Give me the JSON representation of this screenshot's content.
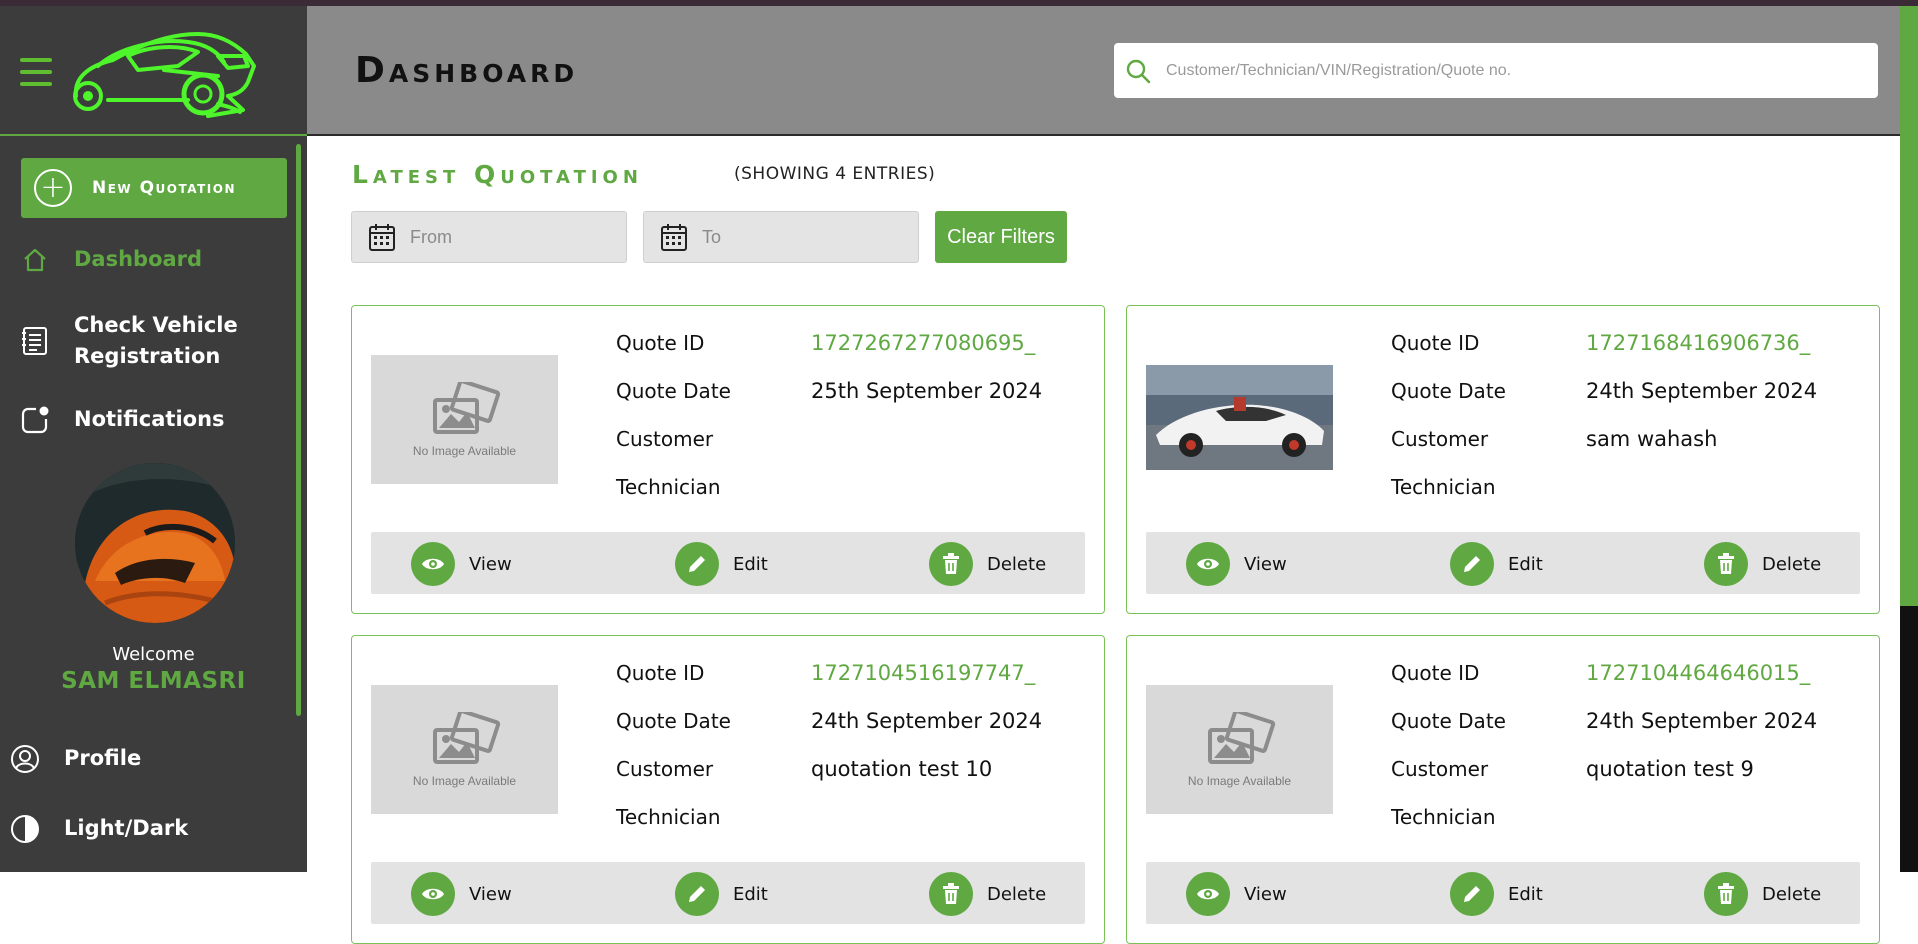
{
  "sidebar": {
    "new_quotation_label": "New Quotation",
    "items": [
      {
        "label": "Dashboard",
        "icon": "home-icon"
      },
      {
        "label": "Check Vehicle\nRegistration",
        "icon": "document-list-icon"
      },
      {
        "label": "Notifications",
        "icon": "notification-icon"
      },
      {
        "label": "Profile",
        "icon": "user-circle-icon"
      },
      {
        "label": "Light/Dark",
        "icon": "contrast-icon"
      }
    ],
    "welcome_text": "Welcome",
    "user_name": "SAM ELMASRI"
  },
  "header": {
    "title": "Dashboard",
    "search_placeholder": "Customer/Technician/VIN/Registration/Quote no."
  },
  "main": {
    "section_title": "Latest Quotation",
    "entries_text": "(SHOWING 4 ENTRIES)",
    "from_placeholder": "From",
    "to_placeholder": "To",
    "clear_filters_label": "Clear Filters",
    "field_labels": {
      "quote_id": "Quote ID",
      "quote_date": "Quote Date",
      "customer": "Customer",
      "technician": "Technician"
    },
    "no_image_text": "No Image Available",
    "actions": {
      "view": "View",
      "edit": "Edit",
      "delete": "Delete"
    },
    "cards": [
      {
        "quote_id": "1727267277080695_",
        "quote_date": "25th September 2024",
        "customer": "",
        "technician": ""
      },
      {
        "quote_id": "1727168416906736_",
        "quote_date": "24th September 2024",
        "customer": "sam wahash",
        "technician": ""
      },
      {
        "quote_id": "1727104516197747_",
        "quote_date": "24th September 2024",
        "customer": "quotation test 10",
        "technician": ""
      },
      {
        "quote_id": "1727104464646015_",
        "quote_date": "24th September 2024",
        "customer": "quotation test 9",
        "technician": ""
      }
    ]
  },
  "colors": {
    "accent": "#5fa842",
    "sidebar_bg": "#3c3c3c",
    "header_bg": "#8a8a8a",
    "logo": "#4df52a"
  }
}
